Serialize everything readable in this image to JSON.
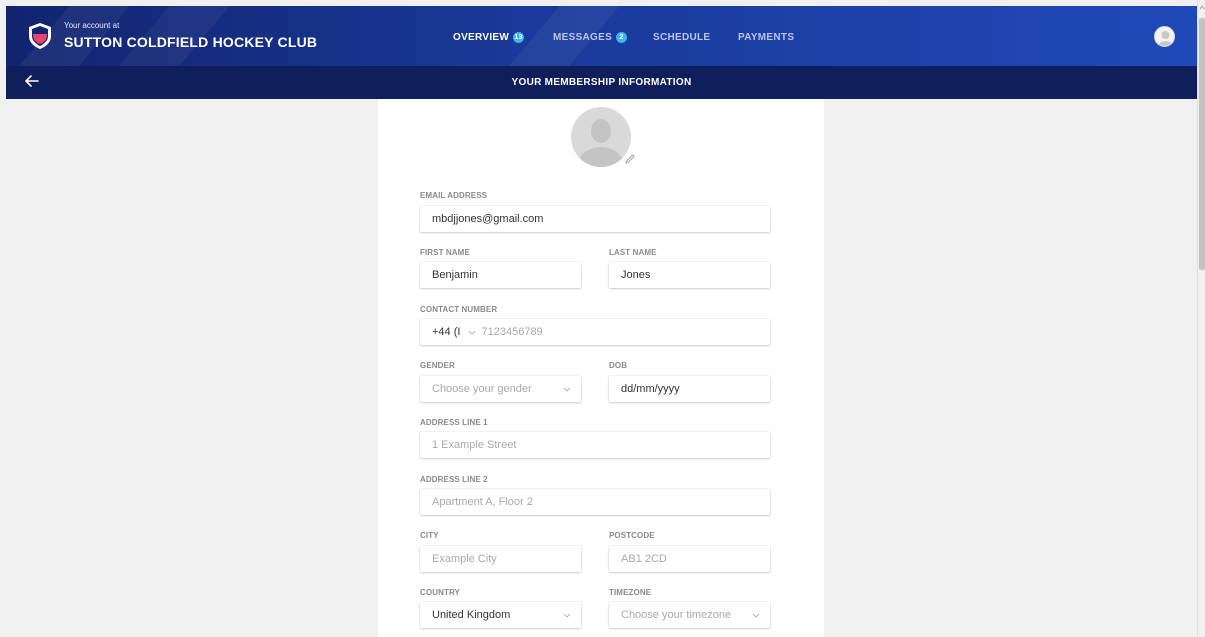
{
  "header": {
    "account_prefix": "Your account at",
    "club_name": "SUTTON COLDFIELD HOCKEY CLUB",
    "nav": [
      {
        "label": "OVERVIEW",
        "badge": "13",
        "active": true
      },
      {
        "label": "MESSAGES",
        "badge": "2",
        "active": false
      },
      {
        "label": "SCHEDULE",
        "active": false
      },
      {
        "label": "PAYMENTS",
        "active": false
      }
    ],
    "colors": {
      "primary": "#1a3a9a",
      "subbar": "#0f1f5c",
      "badge": "#38b6ef",
      "logo_accent": "#e8436e"
    }
  },
  "subheader": {
    "title": "YOUR MEMBERSHIP INFORMATION"
  },
  "form": {
    "email": {
      "label": "EMAIL ADDRESS",
      "value": "mbdjjones@gmail.com"
    },
    "first_name": {
      "label": "FIRST NAME",
      "value": "Benjamin"
    },
    "last_name": {
      "label": "LAST NAME",
      "value": "Jones"
    },
    "contact": {
      "label": "CONTACT NUMBER",
      "country_code": "+44 (I",
      "placeholder": "7123456789"
    },
    "gender": {
      "label": "GENDER",
      "placeholder": "Choose your gender"
    },
    "dob": {
      "label": "DOB",
      "value": "dd/mm/yyyy"
    },
    "address1": {
      "label": "ADDRESS LINE 1",
      "placeholder": "1 Example Street"
    },
    "address2": {
      "label": "ADDRESS LINE 2",
      "placeholder": "Apartment A, Floor 2"
    },
    "city": {
      "label": "CITY",
      "placeholder": "Example City"
    },
    "postcode": {
      "label": "POSTCODE",
      "placeholder": "AB1 2CD"
    },
    "country": {
      "label": "COUNTRY",
      "value": "United Kingdom"
    },
    "timezone": {
      "label": "TIMEZONE",
      "placeholder": "Choose your timezone"
    }
  }
}
